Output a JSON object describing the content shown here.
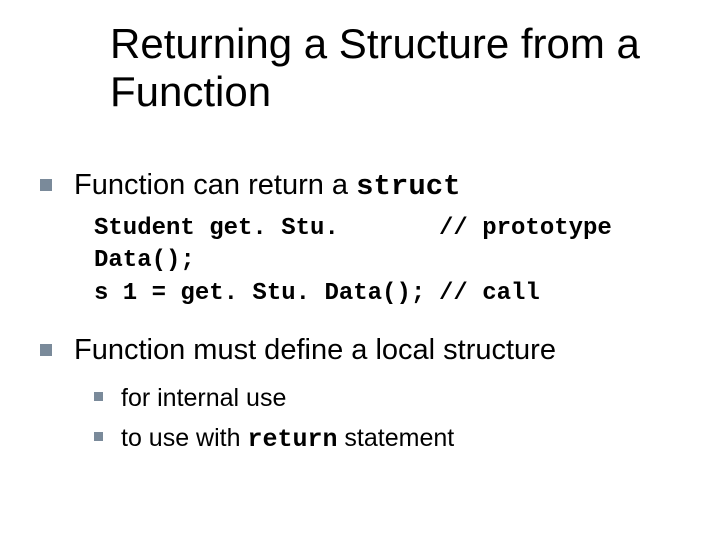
{
  "title": "Returning a Structure from a Function",
  "bullets": [
    {
      "pre": "Function can return a ",
      "code": "struct"
    },
    {
      "pre": "Function must define a local structure",
      "code": ""
    }
  ],
  "code": {
    "lines": [
      {
        "left": "Student get. Stu. Data();",
        "right": "// prototype"
      },
      {
        "left": "s 1 = get. Stu. Data();",
        "right": "// call"
      }
    ]
  },
  "subbullets": [
    {
      "pre": "for internal use",
      "code": ""
    },
    {
      "pre": "to use with ",
      "code": "return",
      "post": " statement"
    }
  ]
}
